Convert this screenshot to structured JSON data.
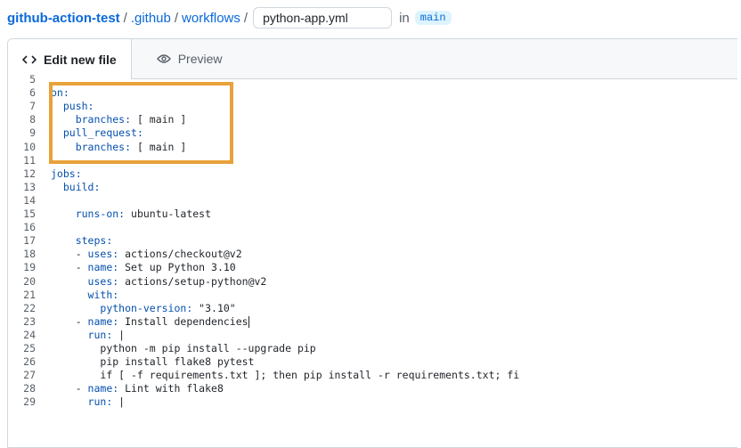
{
  "breadcrumb": {
    "repo": "github-action-test",
    "sep": "/",
    "dir1": ".github",
    "dir2": "workflows",
    "filename": "python-app.yml",
    "in_label": "in",
    "branch": "main"
  },
  "tabs": {
    "edit": "Edit new file",
    "preview": "Preview"
  },
  "highlight_color": "#e8a23a",
  "code_lines": [
    {
      "n": "5",
      "indent": "",
      "key": "",
      "rest": ""
    },
    {
      "n": "6",
      "indent": "",
      "key": "on:",
      "rest": ""
    },
    {
      "n": "7",
      "indent": "  ",
      "key": "push:",
      "rest": ""
    },
    {
      "n": "8",
      "indent": "    ",
      "key": "branches:",
      "rest": " [ main ]"
    },
    {
      "n": "9",
      "indent": "  ",
      "key": "pull_request:",
      "rest": ""
    },
    {
      "n": "10",
      "indent": "    ",
      "key": "branches:",
      "rest": " [ main ]"
    },
    {
      "n": "11",
      "indent": "",
      "key": "",
      "rest": ""
    },
    {
      "n": "12",
      "indent": "",
      "key": "jobs:",
      "rest": ""
    },
    {
      "n": "13",
      "indent": "  ",
      "key": "build:",
      "rest": ""
    },
    {
      "n": "14",
      "indent": "",
      "key": "",
      "rest": ""
    },
    {
      "n": "15",
      "indent": "    ",
      "key": "runs-on:",
      "rest": " ubuntu-latest"
    },
    {
      "n": "16",
      "indent": "",
      "key": "",
      "rest": ""
    },
    {
      "n": "17",
      "indent": "    ",
      "key": "steps:",
      "rest": ""
    },
    {
      "n": "18",
      "indent": "    - ",
      "key": "uses:",
      "rest": " actions/checkout@v2"
    },
    {
      "n": "19",
      "indent": "    - ",
      "key": "name:",
      "rest": " Set up Python 3.10"
    },
    {
      "n": "20",
      "indent": "      ",
      "key": "uses:",
      "rest": " actions/setup-python@v2"
    },
    {
      "n": "21",
      "indent": "      ",
      "key": "with:",
      "rest": ""
    },
    {
      "n": "22",
      "indent": "        ",
      "key": "python-version:",
      "rest": " \"3.10\""
    },
    {
      "n": "23",
      "indent": "    - ",
      "key": "name:",
      "rest": " Install dependencies",
      "cursor": true
    },
    {
      "n": "24",
      "indent": "      ",
      "key": "run:",
      "rest": " |"
    },
    {
      "n": "25",
      "indent": "        ",
      "key": "",
      "rest": "python -m pip install --upgrade pip"
    },
    {
      "n": "26",
      "indent": "        ",
      "key": "",
      "rest": "pip install flake8 pytest"
    },
    {
      "n": "27",
      "indent": "        ",
      "key": "",
      "rest": "if [ -f requirements.txt ]; then pip install -r requirements.txt; fi"
    },
    {
      "n": "28",
      "indent": "    - ",
      "key": "name:",
      "rest": " Lint with flake8"
    },
    {
      "n": "29",
      "indent": "      ",
      "key": "run:",
      "rest": " |"
    }
  ]
}
